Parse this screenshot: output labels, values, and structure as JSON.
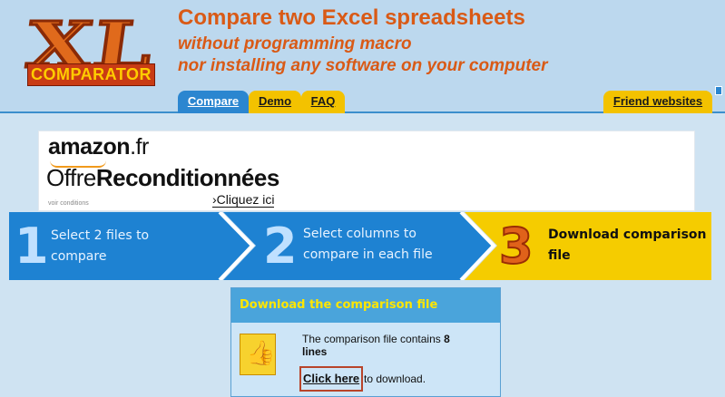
{
  "header": {
    "logo_text": "XL",
    "logo_subtext": "COMPARATOR",
    "title": "Compare two Excel spreadsheets",
    "subtitle_line1": "without programming macro",
    "subtitle_line2": "nor installing any software on your computer",
    "tabs": [
      {
        "label": "Compare",
        "active": true
      },
      {
        "label": "Demo",
        "active": false
      },
      {
        "label": "FAQ",
        "active": false
      }
    ],
    "friend_websites_label": "Friend websites",
    "colors": {
      "accent": "#d95a16",
      "tab_active": "#2b86d0",
      "tab": "#f3c200"
    }
  },
  "ad": {
    "brand": "amazon",
    "brand_suffix": ".fr",
    "headline_light": "Offre",
    "headline_bold": "Reconditionnées",
    "conditions": "voir conditions",
    "link_label": "›Cliquez ici"
  },
  "steps": [
    {
      "number": "1",
      "text_line1": "Select 2 files to",
      "text_line2": "compare",
      "active": false
    },
    {
      "number": "2",
      "text_line1": "Select columns to",
      "text_line2": "compare in each file",
      "active": false
    },
    {
      "number": "3",
      "text_line1": "Download comparison",
      "text_line2": "file",
      "active": true
    }
  ],
  "download_panel": {
    "title": "Download the comparison file",
    "line_prefix": "The comparison file contains ",
    "line_count": "8",
    "line_suffix": "lines",
    "link_label": "Click here",
    "link_suffix": " to download.",
    "icon": "thumbs-up-icon"
  }
}
